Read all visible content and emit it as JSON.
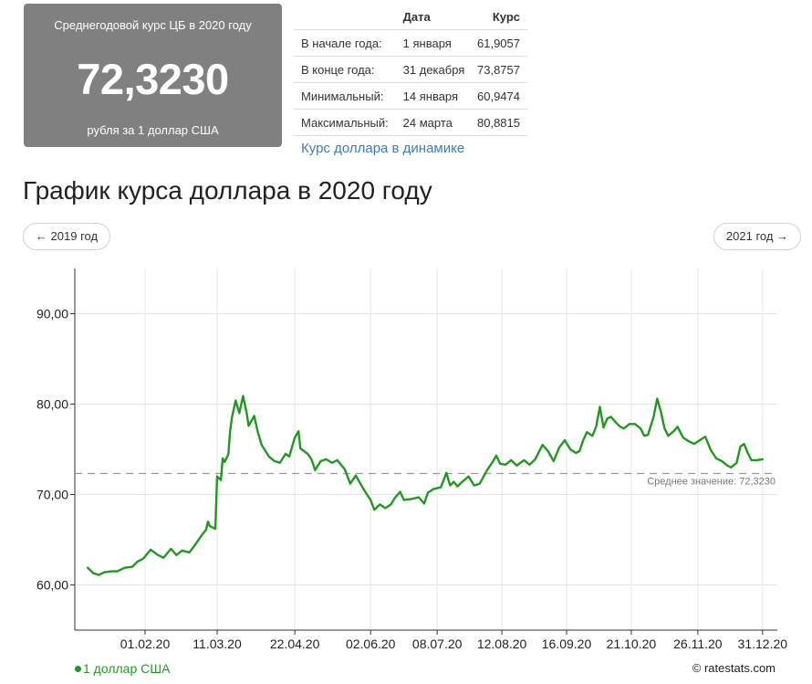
{
  "summary": {
    "caption": "Среднегодовой курс ЦБ в 2020 году",
    "value": "72,3230",
    "unit": "рубля за 1 доллар США"
  },
  "stats_table": {
    "headers": [
      "",
      "Дата",
      "Курс"
    ],
    "rows": [
      {
        "label": "В начале года:",
        "date": "1 января",
        "rate": "61,9057"
      },
      {
        "label": "В конце года:",
        "date": "31 декабря",
        "rate": "73,8757"
      },
      {
        "label": "Минимальный:",
        "date": "14 января",
        "rate": "60,9474"
      },
      {
        "label": "Максимальный:",
        "date": "24 марта",
        "rate": "80,8815"
      }
    ],
    "link_label": "Курс доллара в динамике"
  },
  "page_title": "График курса доллара в 2020 году",
  "nav": {
    "prev_label": "← 2019 год",
    "next_label": "2021 год →"
  },
  "legend_label": "1 доллар США",
  "credit": "© ratestats.com",
  "chart_data": {
    "type": "line",
    "title": "",
    "xlabel": "",
    "ylabel": "",
    "xlim": [
      "2019-12-25",
      "2021-01-08"
    ],
    "ylim": [
      55,
      95
    ],
    "y_ticks": [
      60,
      70,
      80,
      90
    ],
    "y_tick_labels": [
      "60,00",
      "70,00",
      "80,00",
      "90,00"
    ],
    "x_ticks": [
      "2020-02-01",
      "2020-03-11",
      "2020-04-22",
      "2020-06-02",
      "2020-07-08",
      "2020-08-12",
      "2020-09-16",
      "2020-10-21",
      "2020-11-26",
      "2020-12-31"
    ],
    "x_tick_labels": [
      "01.02.20",
      "11.03.20",
      "22.04.20",
      "02.06.20",
      "08.07.20",
      "12.08.20",
      "16.09.20",
      "21.10.20",
      "26.11.20",
      "31.12.20"
    ],
    "grid": true,
    "legend_position": "bottom-left",
    "average": {
      "value": 72.323,
      "label": "Среднее значение: 72,3230"
    },
    "colors": {
      "series": "#1f9a1f",
      "grid": "#e4e4e4",
      "average_line": "#999999"
    },
    "series": [
      {
        "name": "1 доллар США",
        "points": [
          [
            "2020-01-01",
            61.9
          ],
          [
            "2020-01-04",
            61.3
          ],
          [
            "2020-01-07",
            61.1
          ],
          [
            "2020-01-10",
            61.4
          ],
          [
            "2020-01-14",
            61.5
          ],
          [
            "2020-01-17",
            61.5
          ],
          [
            "2020-01-21",
            61.9
          ],
          [
            "2020-01-25",
            62.0
          ],
          [
            "2020-01-28",
            62.6
          ],
          [
            "2020-01-31",
            62.9
          ],
          [
            "2020-02-04",
            63.9
          ],
          [
            "2020-02-08",
            63.3
          ],
          [
            "2020-02-11",
            63.0
          ],
          [
            "2020-02-15",
            64.0
          ],
          [
            "2020-02-18",
            63.3
          ],
          [
            "2020-02-21",
            63.8
          ],
          [
            "2020-02-25",
            63.6
          ],
          [
            "2020-02-28",
            64.4
          ],
          [
            "2020-03-03",
            65.6
          ],
          [
            "2020-03-05",
            66.1
          ],
          [
            "2020-03-06",
            67.0
          ],
          [
            "2020-03-07",
            66.5
          ],
          [
            "2020-03-10",
            66.2
          ],
          [
            "2020-03-11",
            72.0
          ],
          [
            "2020-03-13",
            71.6
          ],
          [
            "2020-03-14",
            74.0
          ],
          [
            "2020-03-15",
            73.6
          ],
          [
            "2020-03-17",
            74.4
          ],
          [
            "2020-03-18",
            77.0
          ],
          [
            "2020-03-19",
            78.5
          ],
          [
            "2020-03-21",
            80.4
          ],
          [
            "2020-03-23",
            79.0
          ],
          [
            "2020-03-25",
            80.9
          ],
          [
            "2020-03-27",
            79.0
          ],
          [
            "2020-03-28",
            77.6
          ],
          [
            "2020-03-31",
            78.7
          ],
          [
            "2020-04-02",
            76.9
          ],
          [
            "2020-04-04",
            75.5
          ],
          [
            "2020-04-08",
            74.2
          ],
          [
            "2020-04-11",
            73.7
          ],
          [
            "2020-04-14",
            73.5
          ],
          [
            "2020-04-17",
            74.5
          ],
          [
            "2020-04-19",
            74.2
          ],
          [
            "2020-04-22",
            76.3
          ],
          [
            "2020-04-24",
            77.0
          ],
          [
            "2020-04-25",
            75.1
          ],
          [
            "2020-04-29",
            74.5
          ],
          [
            "2020-05-01",
            73.9
          ],
          [
            "2020-05-03",
            72.7
          ],
          [
            "2020-05-06",
            73.7
          ],
          [
            "2020-05-09",
            73.9
          ],
          [
            "2020-05-12",
            73.5
          ],
          [
            "2020-05-15",
            73.8
          ],
          [
            "2020-05-19",
            72.8
          ],
          [
            "2020-05-22",
            71.2
          ],
          [
            "2020-05-25",
            72.1
          ],
          [
            "2020-05-28",
            71.0
          ],
          [
            "2020-05-31",
            70.0
          ],
          [
            "2020-06-02",
            69.4
          ],
          [
            "2020-06-04",
            68.3
          ],
          [
            "2020-06-07",
            68.9
          ],
          [
            "2020-06-10",
            68.5
          ],
          [
            "2020-06-13",
            68.9
          ],
          [
            "2020-06-15",
            69.6
          ],
          [
            "2020-06-18",
            70.3
          ],
          [
            "2020-06-20",
            69.4
          ],
          [
            "2020-06-24",
            69.5
          ],
          [
            "2020-06-28",
            69.7
          ],
          [
            "2020-07-01",
            69.0
          ],
          [
            "2020-07-03",
            70.2
          ],
          [
            "2020-07-06",
            70.6
          ],
          [
            "2020-07-10",
            70.8
          ],
          [
            "2020-07-13",
            72.4
          ],
          [
            "2020-07-15",
            71.0
          ],
          [
            "2020-07-17",
            71.4
          ],
          [
            "2020-07-19",
            70.9
          ],
          [
            "2020-07-21",
            71.3
          ],
          [
            "2020-07-25",
            72.0
          ],
          [
            "2020-07-28",
            71.0
          ],
          [
            "2020-07-31",
            71.2
          ],
          [
            "2020-08-04",
            72.7
          ],
          [
            "2020-08-07",
            73.6
          ],
          [
            "2020-08-09",
            74.3
          ],
          [
            "2020-08-11",
            73.4
          ],
          [
            "2020-08-14",
            73.3
          ],
          [
            "2020-08-17",
            73.8
          ],
          [
            "2020-08-20",
            73.2
          ],
          [
            "2020-08-24",
            73.8
          ],
          [
            "2020-08-27",
            73.3
          ],
          [
            "2020-08-30",
            73.9
          ],
          [
            "2020-09-03",
            75.5
          ],
          [
            "2020-09-06",
            74.8
          ],
          [
            "2020-09-09",
            73.7
          ],
          [
            "2020-09-12",
            75.2
          ],
          [
            "2020-09-15",
            76.0
          ],
          [
            "2020-09-18",
            75.0
          ],
          [
            "2020-09-21",
            74.6
          ],
          [
            "2020-09-23",
            74.8
          ],
          [
            "2020-09-25",
            76.0
          ],
          [
            "2020-09-27",
            76.9
          ],
          [
            "2020-09-30",
            76.5
          ],
          [
            "2020-10-02",
            77.5
          ],
          [
            "2020-10-04",
            79.7
          ],
          [
            "2020-10-06",
            77.4
          ],
          [
            "2020-10-08",
            78.4
          ],
          [
            "2020-10-10",
            78.6
          ],
          [
            "2020-10-13",
            77.9
          ],
          [
            "2020-10-15",
            77.5
          ],
          [
            "2020-10-17",
            77.3
          ],
          [
            "2020-10-20",
            77.8
          ],
          [
            "2020-10-23",
            77.8
          ],
          [
            "2020-10-26",
            77.3
          ],
          [
            "2020-10-28",
            76.5
          ],
          [
            "2020-10-30",
            76.6
          ],
          [
            "2020-11-02",
            78.5
          ],
          [
            "2020-11-04",
            80.6
          ],
          [
            "2020-11-06",
            79.2
          ],
          [
            "2020-11-08",
            77.3
          ],
          [
            "2020-11-10",
            76.5
          ],
          [
            "2020-11-13",
            77.0
          ],
          [
            "2020-11-15",
            77.5
          ],
          [
            "2020-11-18",
            76.3
          ],
          [
            "2020-11-21",
            75.9
          ],
          [
            "2020-11-24",
            75.6
          ],
          [
            "2020-11-27",
            76.0
          ],
          [
            "2020-11-30",
            76.4
          ],
          [
            "2020-12-03",
            74.9
          ],
          [
            "2020-12-06",
            74.0
          ],
          [
            "2020-12-09",
            73.7
          ],
          [
            "2020-12-12",
            73.2
          ],
          [
            "2020-12-14",
            73.0
          ],
          [
            "2020-12-17",
            73.5
          ],
          [
            "2020-12-19",
            75.3
          ],
          [
            "2020-12-21",
            75.6
          ],
          [
            "2020-12-23",
            74.6
          ],
          [
            "2020-12-25",
            73.8
          ],
          [
            "2020-12-28",
            73.8
          ],
          [
            "2020-12-31",
            73.9
          ]
        ]
      }
    ]
  }
}
